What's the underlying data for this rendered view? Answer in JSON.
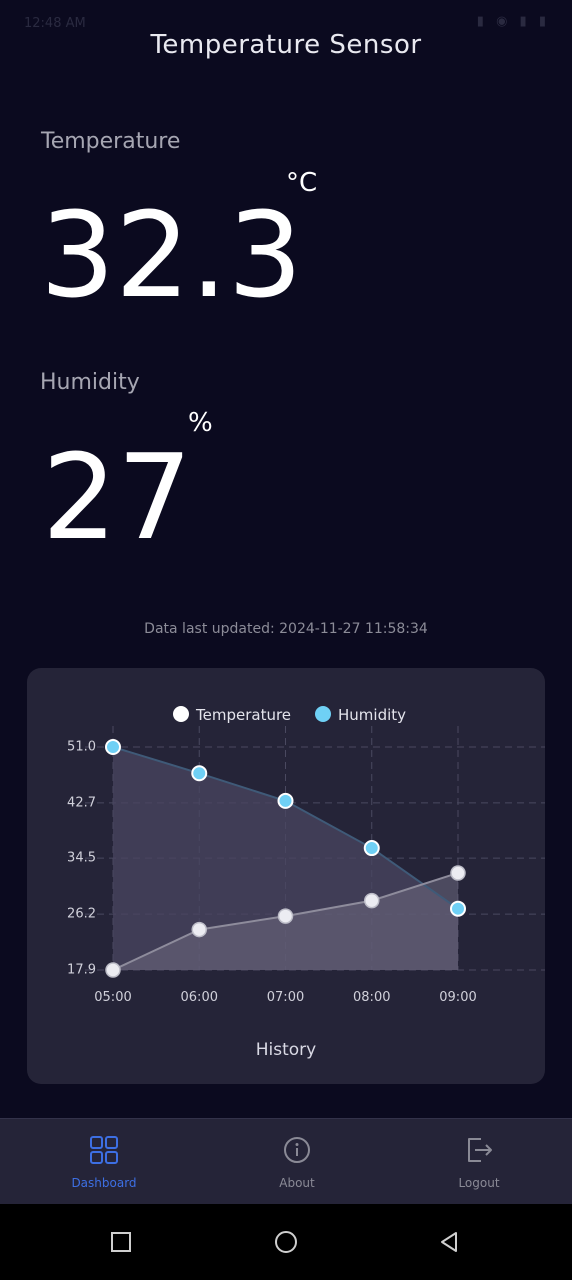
{
  "status_bar": {
    "time": "12:48 AM"
  },
  "app": {
    "title": "Temperature Sensor"
  },
  "temperature": {
    "label": "Temperature",
    "value": "32.3",
    "unit": "°C"
  },
  "humidity": {
    "label": "Humidity",
    "value": "27",
    "unit": "%"
  },
  "last_updated": "Data last updated: 2024-11-27 11:58:34",
  "chart_data": {
    "type": "area",
    "caption": "History",
    "categories": [
      "05:00",
      "06:00",
      "07:00",
      "08:00",
      "09:00"
    ],
    "y_ticks": [
      "51.0",
      "42.7",
      "34.5",
      "26.2",
      "17.9"
    ],
    "ylim": [
      17.9,
      51.0
    ],
    "grid": true,
    "legend_position": "top",
    "series": [
      {
        "name": "Temperature",
        "color": "#ffffff",
        "values": [
          17.9,
          23.9,
          25.9,
          28.2,
          32.3
        ]
      },
      {
        "name": "Humidity",
        "color": "#6fd0f5",
        "values": [
          51.0,
          47.1,
          43.0,
          36.0,
          27.0
        ]
      }
    ]
  },
  "bottom_nav": {
    "items": [
      {
        "label": "Dashboard",
        "icon": "grid-icon",
        "active": true
      },
      {
        "label": "About",
        "icon": "info-icon",
        "active": false
      },
      {
        "label": "Logout",
        "icon": "logout-icon",
        "active": false
      }
    ],
    "active_color": "#3d6fe3",
    "inactive_color": "#8a8a96"
  }
}
